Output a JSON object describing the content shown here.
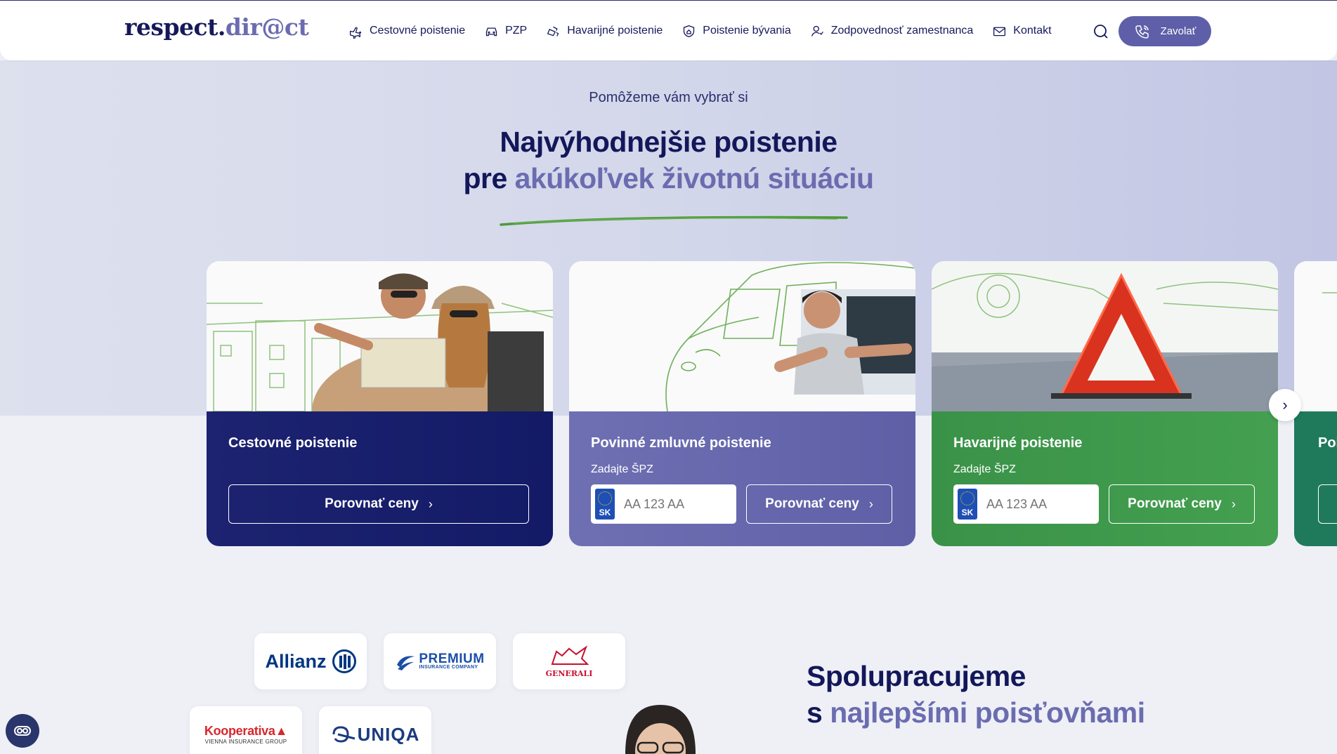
{
  "header": {
    "logo_main": "respect.",
    "logo_accent": "dir@ct",
    "nav": [
      {
        "label": "Cestovné poistenie",
        "icon": "plane-icon"
      },
      {
        "label": "PZP",
        "icon": "car-icon"
      },
      {
        "label": "Havarijné poistenie",
        "icon": "crash-icon"
      },
      {
        "label": "Poistenie bývania",
        "icon": "house-shield-icon"
      },
      {
        "label": "Zodpovednosť zamestnanca",
        "icon": "person-icon"
      },
      {
        "label": "Kontakt",
        "icon": "mail-icon"
      }
    ],
    "call_label": "Zavolať"
  },
  "hero": {
    "kicker": "Pomôžeme vám vybrať si",
    "title_line1": "Najvýhodnejšie poistenie",
    "title_line2_plain": "pre",
    "title_line2_accent": "akúkoľvek životnú situáciu"
  },
  "cards": [
    {
      "title": "Cestovné poistenie",
      "button": "Porovnať ceny",
      "color": "#1a2070"
    },
    {
      "title": "Povinné zmluvné poistenie",
      "subtitle": "Zadajte ŠPZ",
      "placeholder": "AA 123 AA",
      "flag": "SK",
      "button": "Porovnať ceny",
      "color": "#6a6bb0"
    },
    {
      "title": "Havarijné poistenie",
      "subtitle": "Zadajte ŠPZ",
      "placeholder": "AA 123 AA",
      "flag": "SK",
      "button": "Porovnať ceny",
      "color": "#3f9a4a"
    },
    {
      "title": "Poi",
      "color": "#1f7a5c"
    }
  ],
  "partners": {
    "title_line1": "Spolupracujeme",
    "title_line2_plain": "s",
    "title_line2_accent": "najlepšími poisťovňami",
    "logos": {
      "allianz": "Allianz",
      "premium": "PREMIUM",
      "premium_sub": "INSURANCE COMPANY",
      "generali": "GENERALI",
      "kooperativa": "Kooperativa",
      "kooperativa_sub": "VIENNA INSURANCE GROUP",
      "uniqa": "UNIQA"
    }
  },
  "colors": {
    "navy": "#15195a",
    "accent": "#6b6cb0",
    "green_stroke": "#4c9a3a"
  }
}
